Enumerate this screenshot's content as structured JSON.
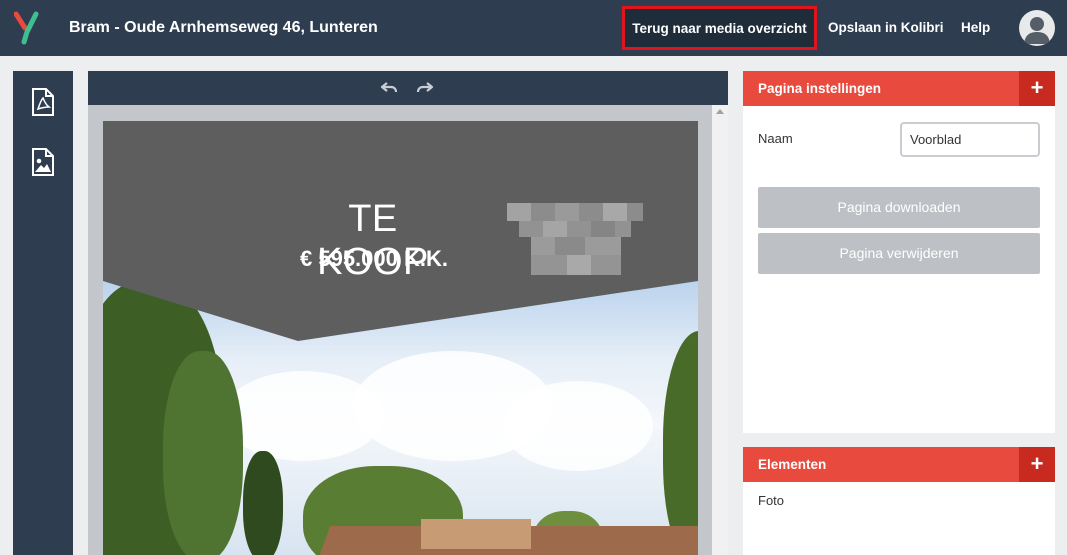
{
  "header": {
    "app_title": "Bram - Oude Arnhemseweg 46, Lunteren",
    "back_label": "Terug naar media overzicht",
    "save_label": "Opslaan in Kolibri",
    "help_label": "Help"
  },
  "sidebar": {
    "items": [
      {
        "icon": "pdf-file-icon"
      },
      {
        "icon": "image-file-icon"
      }
    ]
  },
  "editor": {
    "page": {
      "title": "TE KOOP",
      "price": "€ 595.000 K.K."
    }
  },
  "settings_panel": {
    "title": "Pagina instellingen",
    "add_label": "+",
    "name_label": "Naam",
    "name_value": "Voorblad",
    "download_label": "Pagina downloaden",
    "delete_label": "Pagina verwijderen"
  },
  "elements_panel": {
    "title": "Elementen",
    "add_label": "+",
    "items": [
      "Foto"
    ]
  },
  "colors": {
    "navbar": "#2e3e50",
    "accent": "#e84a3e",
    "accent_dark": "#c82a20",
    "highlight": "#e0141c"
  }
}
